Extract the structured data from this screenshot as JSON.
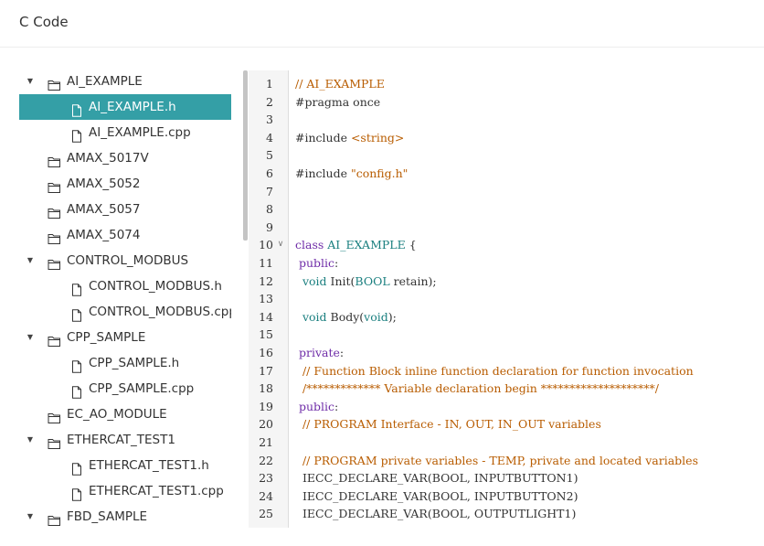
{
  "header": {
    "title": "C Code"
  },
  "tree": {
    "items": [
      {
        "label": "AI_EXAMPLE",
        "level": 0,
        "type": "folder",
        "expanded": true,
        "selected": false
      },
      {
        "label": "AI_EXAMPLE.h",
        "level": 1,
        "type": "file",
        "selected": true
      },
      {
        "label": "AI_EXAMPLE.cpp",
        "level": 1,
        "type": "file",
        "selected": false
      },
      {
        "label": "AMAX_5017V",
        "level": 0,
        "type": "folder",
        "expanded": null,
        "selected": false
      },
      {
        "label": "AMAX_5052",
        "level": 0,
        "type": "folder",
        "expanded": null,
        "selected": false
      },
      {
        "label": "AMAX_5057",
        "level": 0,
        "type": "folder",
        "expanded": null,
        "selected": false
      },
      {
        "label": "AMAX_5074",
        "level": 0,
        "type": "folder",
        "expanded": null,
        "selected": false
      },
      {
        "label": "CONTROL_MODBUS",
        "level": 0,
        "type": "folder",
        "expanded": true,
        "selected": false
      },
      {
        "label": "CONTROL_MODBUS.h",
        "level": 1,
        "type": "file",
        "selected": false
      },
      {
        "label": "CONTROL_MODBUS.cpp",
        "level": 1,
        "type": "file",
        "selected": false
      },
      {
        "label": "CPP_SAMPLE",
        "level": 0,
        "type": "folder",
        "expanded": true,
        "selected": false
      },
      {
        "label": "CPP_SAMPLE.h",
        "level": 1,
        "type": "file",
        "selected": false
      },
      {
        "label": "CPP_SAMPLE.cpp",
        "level": 1,
        "type": "file",
        "selected": false
      },
      {
        "label": "EC_AO_MODULE",
        "level": 0,
        "type": "folder",
        "expanded": null,
        "selected": false
      },
      {
        "label": "ETHERCAT_TEST1",
        "level": 0,
        "type": "folder",
        "expanded": true,
        "selected": false
      },
      {
        "label": "ETHERCAT_TEST1.h",
        "level": 1,
        "type": "file",
        "selected": false
      },
      {
        "label": "ETHERCAT_TEST1.cpp",
        "level": 1,
        "type": "file",
        "selected": false
      },
      {
        "label": "FBD_SAMPLE",
        "level": 0,
        "type": "folder",
        "expanded": true,
        "selected": false
      }
    ]
  },
  "editor": {
    "lines": [
      {
        "n": "1",
        "fold": false,
        "tokens": [
          {
            "t": "// AI_EXAMPLE",
            "c": "comment"
          }
        ]
      },
      {
        "n": "2",
        "fold": false,
        "tokens": [
          {
            "t": "#pragma once",
            "c": "text"
          }
        ]
      },
      {
        "n": "3",
        "fold": false,
        "tokens": []
      },
      {
        "n": "4",
        "fold": false,
        "tokens": [
          {
            "t": "#include ",
            "c": "text"
          },
          {
            "t": "<string>",
            "c": "string"
          }
        ]
      },
      {
        "n": "5",
        "fold": false,
        "tokens": []
      },
      {
        "n": "6",
        "fold": false,
        "tokens": [
          {
            "t": "#include ",
            "c": "text"
          },
          {
            "t": "\"config.h\"",
            "c": "string"
          }
        ]
      },
      {
        "n": "7",
        "fold": false,
        "tokens": []
      },
      {
        "n": "8",
        "fold": false,
        "tokens": []
      },
      {
        "n": "9",
        "fold": false,
        "tokens": []
      },
      {
        "n": "10",
        "fold": true,
        "tokens": [
          {
            "t": "class ",
            "c": "keyword"
          },
          {
            "t": "AI_EXAMPLE",
            "c": "type"
          },
          {
            "t": " {",
            "c": "text"
          }
        ]
      },
      {
        "n": "11",
        "fold": false,
        "tokens": [
          {
            "t": " public",
            "c": "keyword"
          },
          {
            "t": ":",
            "c": "text"
          }
        ]
      },
      {
        "n": "12",
        "fold": false,
        "tokens": [
          {
            "t": "  ",
            "c": "text"
          },
          {
            "t": "void",
            "c": "type"
          },
          {
            "t": " Init(",
            "c": "text"
          },
          {
            "t": "BOOL",
            "c": "type"
          },
          {
            "t": " retain);",
            "c": "text"
          }
        ]
      },
      {
        "n": "13",
        "fold": false,
        "tokens": []
      },
      {
        "n": "14",
        "fold": false,
        "tokens": [
          {
            "t": "  ",
            "c": "text"
          },
          {
            "t": "void",
            "c": "type"
          },
          {
            "t": " Body(",
            "c": "text"
          },
          {
            "t": "void",
            "c": "type"
          },
          {
            "t": ");",
            "c": "text"
          }
        ]
      },
      {
        "n": "15",
        "fold": false,
        "tokens": []
      },
      {
        "n": "16",
        "fold": false,
        "tokens": [
          {
            "t": " private",
            "c": "keyword"
          },
          {
            "t": ":",
            "c": "text"
          }
        ]
      },
      {
        "n": "17",
        "fold": false,
        "tokens": [
          {
            "t": "  // Function Block inline function declaration for function invocation",
            "c": "comment"
          }
        ]
      },
      {
        "n": "18",
        "fold": false,
        "tokens": [
          {
            "t": "  /************* Variable declaration begin ********************/",
            "c": "comment"
          }
        ]
      },
      {
        "n": "19",
        "fold": false,
        "tokens": [
          {
            "t": " public",
            "c": "keyword"
          },
          {
            "t": ":",
            "c": "text"
          }
        ]
      },
      {
        "n": "20",
        "fold": false,
        "tokens": [
          {
            "t": "  // PROGRAM Interface - IN, OUT, IN_OUT variables",
            "c": "comment"
          }
        ]
      },
      {
        "n": "21",
        "fold": false,
        "tokens": []
      },
      {
        "n": "22",
        "fold": false,
        "tokens": [
          {
            "t": "  // PROGRAM private variables - TEMP, private and located variables",
            "c": "comment"
          }
        ]
      },
      {
        "n": "23",
        "fold": false,
        "tokens": [
          {
            "t": "  IECC_DECLARE_VAR(BOOL, INPUTBUTTON1)",
            "c": "text"
          }
        ]
      },
      {
        "n": "24",
        "fold": false,
        "tokens": [
          {
            "t": "  IECC_DECLARE_VAR(BOOL, INPUTBUTTON2)",
            "c": "text"
          }
        ]
      },
      {
        "n": "25",
        "fold": false,
        "tokens": [
          {
            "t": "  IECC_DECLARE_VAR(BOOL, OUTPUTLIGHT1)",
            "c": "text"
          }
        ]
      }
    ]
  }
}
